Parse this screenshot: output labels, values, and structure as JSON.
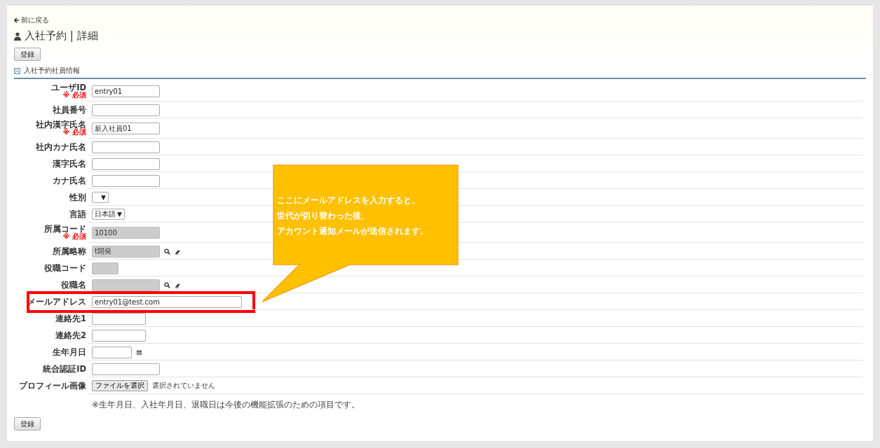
{
  "back_link": "前に戻る",
  "title": "入社予約 | 詳細",
  "top_button": "登録",
  "section": {
    "title": "入社予約社員情報",
    "expanded": true
  },
  "fields": [
    {
      "label": "ユーザID",
      "required_note": "※ 必須",
      "kind": "text",
      "value": "entry01",
      "highlighted": false
    },
    {
      "label": "社員番号",
      "kind": "text",
      "highlighted": false
    },
    {
      "label": "社内漢字氏名",
      "required_note": "※ 必須",
      "kind": "text",
      "value": "新入社員01",
      "highlighted": false
    },
    {
      "label": "社内カナ氏名",
      "kind": "text",
      "highlighted": false
    },
    {
      "label": "漢字氏名",
      "kind": "text",
      "highlighted": false
    },
    {
      "label": "カナ氏名",
      "kind": "text",
      "highlighted": false
    },
    {
      "label": "性別",
      "kind": "select",
      "caret": "▼",
      "highlighted": false
    },
    {
      "label": "言語",
      "kind": "select",
      "value": "日本語",
      "caret": "▼",
      "highlighted": false
    },
    {
      "label": "所属コード",
      "required_note": "※ 必須",
      "kind": "readonly",
      "value": "10100",
      "highlighted": false
    },
    {
      "label": "所属略称",
      "kind": "readonly-lookup",
      "value": "t開発",
      "highlighted": false
    },
    {
      "label": "役職コード",
      "kind": "readonly-short",
      "highlighted": false
    },
    {
      "label": "役職名",
      "kind": "readonly-lookup",
      "highlighted": false
    },
    {
      "label": "メールアドレス",
      "kind": "email",
      "value": "entry01@test.com",
      "highlighted": true
    },
    {
      "label": "連絡先1",
      "kind": "short",
      "highlighted": false
    },
    {
      "label": "連絡先2",
      "kind": "short",
      "highlighted": false
    },
    {
      "label": "生年月日",
      "kind": "date",
      "highlighted": false
    },
    {
      "label": "統合認証ID",
      "kind": "text",
      "highlighted": false
    },
    {
      "label": "プロフィール画像",
      "kind": "file",
      "button": "ファイルを選択",
      "status": "選択されていません",
      "highlighted": false
    }
  ],
  "note": "※生年月日、入社年月日、退職日は今後の機能拡張のための項目です。",
  "bottom_button": "登録",
  "callout": {
    "lines": [
      "ここにメールアドレスを入力すると、",
      "世代が切り替わった後、",
      "アカウント通知メールが送信されます。"
    ]
  }
}
